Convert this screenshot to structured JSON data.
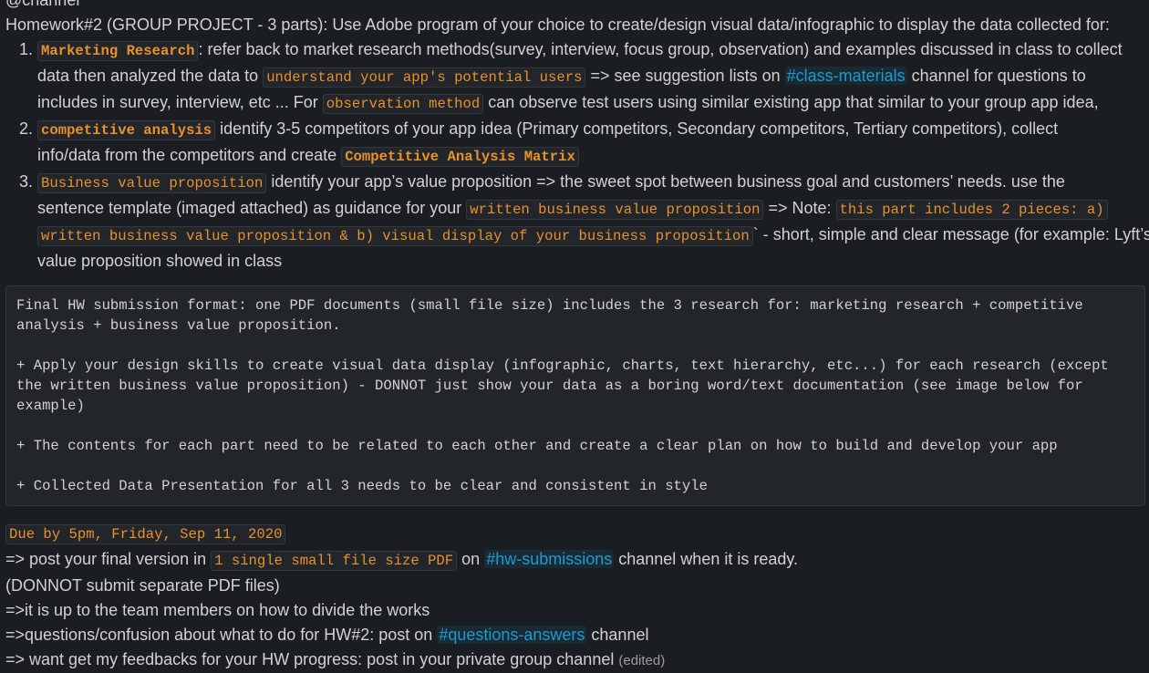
{
  "mention": "@channel",
  "intro": "Homework#2 (GROUP PROJECT - 3 parts): Use Adobe program of your choice to create/design visual data/infographic to display the data collected for:",
  "items": [
    {
      "code1": "Marketing Research",
      "t1": ": refer back to market research methods(survey, interview, focus group, observation) and examples discussed in class to collect",
      "t2": "data then analyzed the data to ",
      "code2": "understand your app's potential users",
      "t3": " => see suggestion lists  on ",
      "channel": "#class-materials",
      "t4": " channel for questions to",
      "t5": "includes in survey, interview, etc ... For ",
      "code3": "observation method",
      "t6": " can observe test users using similar existing app that similar to your group app idea,"
    },
    {
      "code1": "competitive analysis",
      "t1": " identify 3-5 competitors of your app idea (Primary competitors, Secondary competitors, Tertiary competitors), collect",
      "t2": "info/data from the competitors and create ",
      "code2": "Competitive Analysis Matrix"
    },
    {
      "code1": "Business value proposition",
      "t1": " identify your app’s value proposition  => the sweet spot between business goal and customers’ needs. use the",
      "t2": "sentence template (imaged attached) as guidance for your ",
      "code2": "written business value proposition",
      "t3": "  => Note: ",
      "code3": "this part includes 2 pieces: a)",
      "code4": "written business value proposition & b) visual display of your business proposition",
      "t4": "` - short, simple and clear message (for example: Lyft’s",
      "t5": "value proposition showed in class"
    }
  ],
  "code_block": [
    "Final HW submission format: one PDF documents (small file size) includes the 3 research for: marketing research + competitive analysis + business value proposition.",
    "",
    "+ Apply your design skills to create visual data display (infographic, charts, text hierarchy, etc...) for each research (except the written business value proposition) - DONNOT just show your data as a boring word/text documentation (see image below for example)",
    "",
    "+ The contents for each part need to be related to each other and create a clear plan on how to build and develop your app",
    "",
    "+ Collected Data Presentation for all 3 needs to be clear and consistent in style"
  ],
  "due": "Due by 5pm, Friday, Sep 11, 2020",
  "post": {
    "t1": "=> post your final version in ",
    "code": "1 single small file size PDF",
    "t2": " on ",
    "channel": "#hw-submissions",
    "t3": " channel when it is ready."
  },
  "separate": "(DONNOT submit separate PDF files)",
  "divide": "=>it is up to the team members on how to divide the works",
  "questions": {
    "t1": "=>questions/confusion about what to do for HW#2: post on ",
    "channel": "#questions-answers",
    "t2": " channel"
  },
  "feedback": "=> want get my feedbacks for your HW progress: post in your private group channel",
  "edited": "(edited)"
}
